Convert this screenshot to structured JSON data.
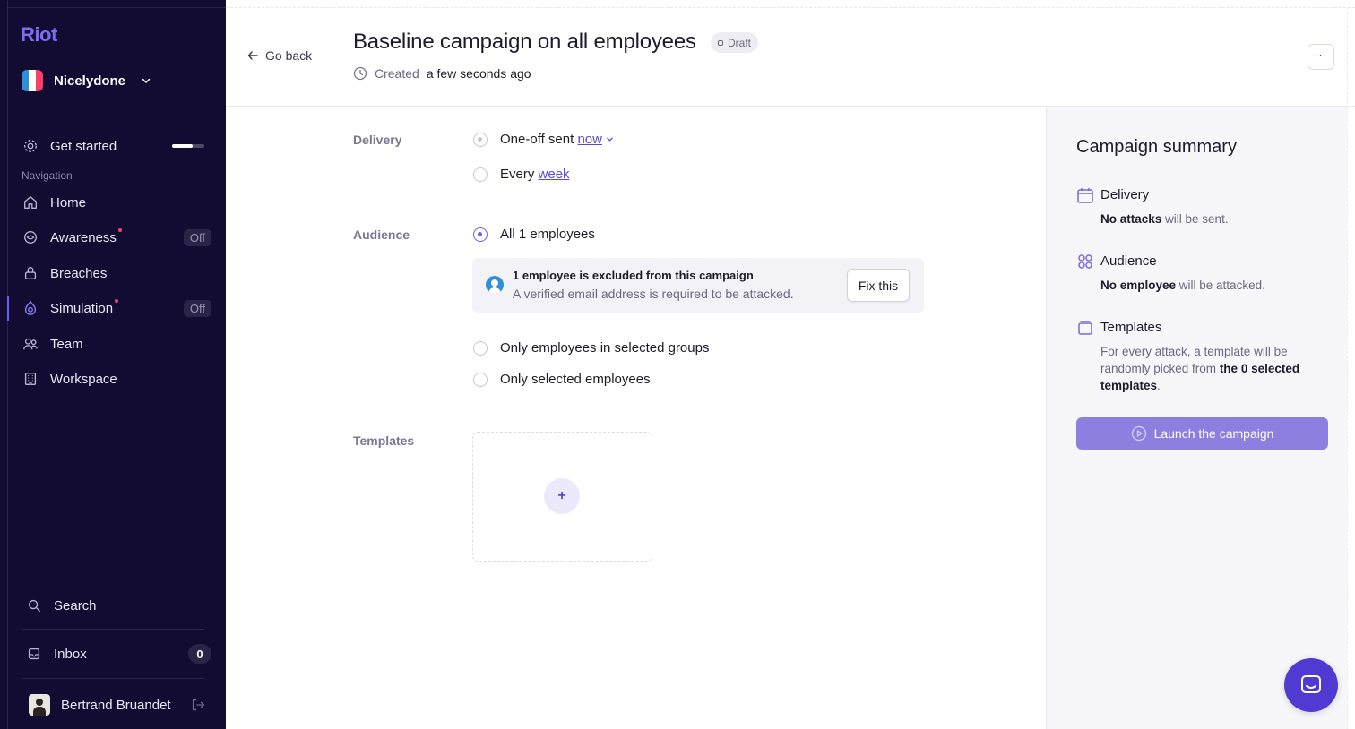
{
  "sidebar": {
    "logo": "Riot",
    "org": {
      "name": "Nicelydone",
      "colors": [
        "#2f8fd8",
        "#ffffff",
        "#ff3d6b"
      ]
    },
    "get_started": {
      "label": "Get started",
      "progress": 0.65
    },
    "section_label": "Navigation",
    "items": [
      {
        "label": "Home",
        "icon": "home-icon"
      },
      {
        "label": "Awareness",
        "icon": "awareness-icon",
        "badge": "Off",
        "dot": true
      },
      {
        "label": "Breaches",
        "icon": "lock-icon"
      },
      {
        "label": "Simulation",
        "icon": "simulation-icon",
        "badge": "Off",
        "dot": true,
        "active": true
      },
      {
        "label": "Team",
        "icon": "team-icon"
      },
      {
        "label": "Workspace",
        "icon": "building-icon"
      }
    ],
    "search_label": "Search",
    "inbox": {
      "label": "Inbox",
      "count": "0"
    },
    "user": {
      "name": "Bertrand Bruandet"
    }
  },
  "header": {
    "go_back": "Go back",
    "title": "Baseline campaign on all employees",
    "status": "Draft",
    "created_prefix": "Created",
    "created_time": "a few seconds ago",
    "more": "···"
  },
  "delivery": {
    "label": "Delivery",
    "option1_prefix": "One-off sent",
    "option1_link": "now",
    "option2_prefix": "Every",
    "option2_link": "week"
  },
  "audience": {
    "label": "Audience",
    "option_all": "All 1 employees",
    "notice_title": "1 employee is excluded from this campaign",
    "notice_text": "A verified email address is required to be attacked.",
    "fix_button": "Fix this",
    "option_groups": "Only employees in selected groups",
    "option_selected": "Only selected employees"
  },
  "templates": {
    "label": "Templates",
    "add": "+"
  },
  "summary": {
    "title": "Campaign summary",
    "delivery": {
      "heading": "Delivery",
      "bold": "No attacks",
      "rest": " will be sent."
    },
    "audience": {
      "heading": "Audience",
      "bold": "No employee",
      "rest": " will be attacked."
    },
    "templates": {
      "heading": "Templates",
      "text": "For every attack, a template will be randomly picked from ",
      "bold": "the 0 selected templates",
      "end": "."
    },
    "launch": "Launch the campaign"
  },
  "colors": {
    "sidebar_bg": "#120c33",
    "accent": "#6e5cf0",
    "launch_bg": "#8c7fe0",
    "chat_bg": "#4f3bd1",
    "notification_dot": "#ff3d6b"
  }
}
